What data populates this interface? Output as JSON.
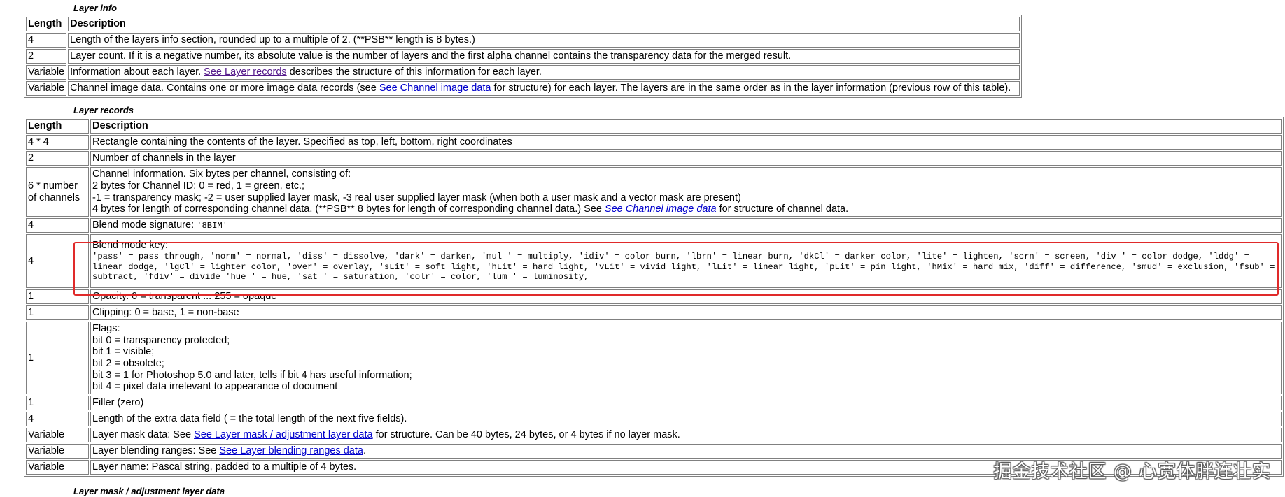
{
  "layer_info": {
    "caption": "Layer info",
    "headers": [
      "Length",
      "Description"
    ],
    "row1": {
      "len": "4",
      "desc": "Length of the layers info section, rounded up to a multiple of 2. (**PSB** length is 8 bytes.)"
    },
    "row2": {
      "len": "2",
      "desc": "Layer count. If it is a negative number, its absolute value is the number of layers and the first alpha channel contains the transparency data for the merged result."
    },
    "row3": {
      "len": "Variable",
      "pre": "Information about each layer. ",
      "link": "See Layer records",
      "post": " describes the structure of this information for each layer."
    },
    "row4": {
      "len": "Variable",
      "pre": "Channel image data. Contains one or more image data records (see ",
      "link": "See Channel image data",
      "post": " for structure) for each layer. The layers are in the same order as in the layer information (previous row of this table)."
    }
  },
  "layer_records": {
    "caption": "Layer records",
    "headers": [
      "Length",
      "Description"
    ],
    "rect": {
      "len": "4 * 4",
      "desc": "Rectangle containing the contents of the layer. Specified as top, left, bottom, right coordinates"
    },
    "channels": {
      "len": "2",
      "desc": "Number of channels in the layer"
    },
    "chaninfo": {
      "len": "6 * number of channels",
      "line1": "Channel information. Six bytes per channel, consisting of:",
      "line2": "2 bytes for Channel ID: 0 = red, 1 = green, etc.;",
      "line3": "-1 = transparency mask; -2 = user supplied layer mask, -3 real user supplied layer mask (when both a user mask and a vector mask are present)",
      "line4_pre": "4 bytes for length of corresponding channel data. (**PSB** 8 bytes for length of corresponding channel data.) See ",
      "line4_link": "See Channel image data",
      "line4_post": " for structure of channel data."
    },
    "sig": {
      "len": "4",
      "pre": "Blend mode signature: ",
      "code": "'8BIM'"
    },
    "blend": {
      "len": "4",
      "title": "Blend mode key:",
      "keys": "'pass' = pass through, 'norm' = normal, 'diss' = dissolve, 'dark' = darken, 'mul ' = multiply, 'idiv' = color burn, 'lbrn' = linear burn, 'dkCl' = darker color, 'lite' = lighten, 'scrn' = screen, 'div ' = color dodge, 'lddg' = linear dodge, 'lgCl' = lighter color, 'over' = overlay, 'sLit' = soft light, 'hLit' = hard light, 'vLit' = vivid light, 'lLit' = linear light, 'pLit' = pin light, 'hMix' = hard mix, 'diff' = difference, 'smud' = exclusion, 'fsub' = subtract, 'fdiv' = divide 'hue ' = hue, 'sat ' = saturation, 'colr' = color, 'lum ' = luminosity,"
    },
    "opacity": {
      "len": "1",
      "desc": "Opacity. 0 = transparent ... 255 = opaque"
    },
    "clipping": {
      "len": "1",
      "desc": "Clipping: 0 = base, 1 = non-base"
    },
    "flags": {
      "len": "1",
      "lines": [
        "Flags:",
        "bit 0 = transparency protected;",
        "bit 1 = visible;",
        "bit 2 = obsolete;",
        "bit 3 = 1 for Photoshop 5.0 and later, tells if bit 4 has useful information;",
        "bit 4 = pixel data irrelevant to appearance of document"
      ]
    },
    "filler": {
      "len": "1",
      "desc": "Filler (zero)"
    },
    "extra": {
      "len": "4",
      "desc": "Length of the extra data field ( = the total length of the next five fields)."
    },
    "mask": {
      "len": "Variable",
      "pre": "Layer mask data: See ",
      "link": "See Layer mask / adjustment layer data",
      "post": " for structure. Can be 40 bytes, 24 bytes, or 4 bytes if no layer mask."
    },
    "ranges": {
      "len": "Variable",
      "pre": "Layer blending ranges: See ",
      "link": "See Layer blending ranges data",
      "post": "."
    },
    "name": {
      "len": "Variable",
      "desc": "Layer name: Pascal string, padded to a multiple of 4 bytes."
    }
  },
  "next_caption": "Layer mask / adjustment layer data",
  "watermark": "掘金技术社区 @ 心宽体胖连壮实",
  "colors": {
    "highlight_box": "#e02a2a",
    "link": "#0000cc",
    "visited_link": "#551a8b",
    "border": "#808080"
  }
}
